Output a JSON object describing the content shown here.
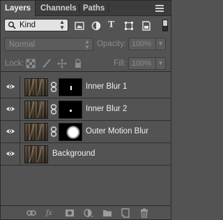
{
  "tabs": [
    {
      "label": "Layers",
      "active": true
    },
    {
      "label": "Channels",
      "active": false
    },
    {
      "label": "Paths",
      "active": false
    }
  ],
  "filter": {
    "kind_label": "Kind",
    "icons": [
      "image-filter-icon",
      "adjustment-filter-icon",
      "type-filter-icon",
      "shape-filter-icon",
      "smart-object-filter-icon"
    ]
  },
  "blend": {
    "mode": "Normal",
    "opacity_label": "Opacity:",
    "opacity_value": "100%"
  },
  "lock": {
    "label": "Lock:",
    "fill_label": "Fill:",
    "fill_value": "100%"
  },
  "layers": [
    {
      "name": "Inner Blur 1",
      "visible": true,
      "mask": "line"
    },
    {
      "name": "Inner Blur 2",
      "visible": true,
      "mask": "dot"
    },
    {
      "name": "Outer Motion Blur",
      "visible": true,
      "mask": "glow"
    },
    {
      "name": "Background",
      "visible": true,
      "mask": "none"
    }
  ],
  "colors": {
    "panel_bg": "#535353",
    "tabbar_bg": "#3c3c3c",
    "text": "#f0f0f0",
    "muted": "#8c8c8c"
  }
}
